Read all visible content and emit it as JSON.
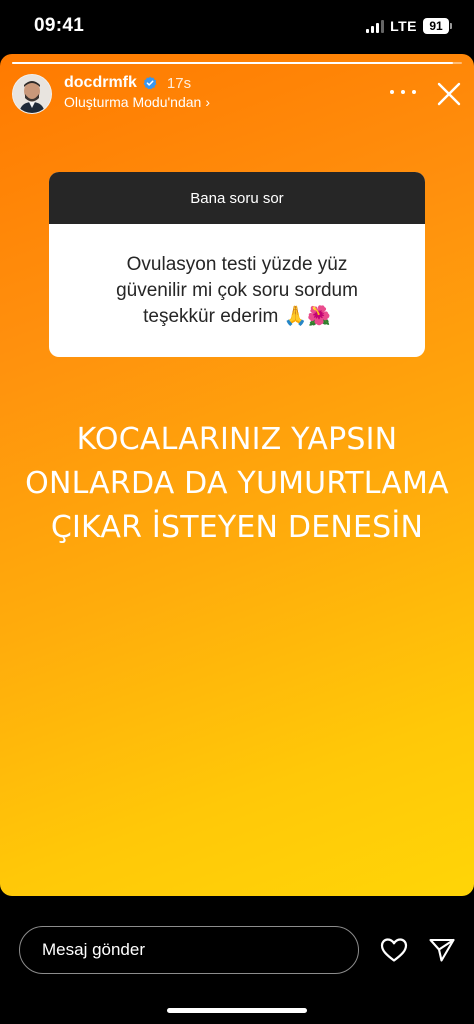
{
  "status_bar": {
    "time": "09:41",
    "network": "LTE",
    "battery": "91"
  },
  "story": {
    "progress_fraction": 0.98,
    "username": "docdrmfk",
    "verified": true,
    "time_ago": "17s",
    "subtitle": "Oluşturma Modu'ndan",
    "question_sticker": {
      "title": "Bana soru sor",
      "question_lines": [
        "Ovulasyon testi yüzde yüz",
        "güvenilir mi çok soru sordum",
        "teşekkür ederim 🙏🌺"
      ]
    },
    "answer_lines": [
      "KOCALARINIZ YAPSIN",
      "ONLARDA DA YUMURTLAMA",
      "ÇIKAR İSTEYEN DENESİN"
    ]
  },
  "footer": {
    "reply_placeholder": "Mesaj gönder"
  },
  "icons": {
    "more": "more-horizontal-icon",
    "close": "close-icon",
    "verified": "verified-badge-icon",
    "heart": "heart-icon",
    "send": "send-icon"
  },
  "colors": {
    "gradient_start": "#ff7a00",
    "gradient_end": "#ffd507",
    "sticker_header": "#262626",
    "verified_blue": "#3897f0"
  }
}
